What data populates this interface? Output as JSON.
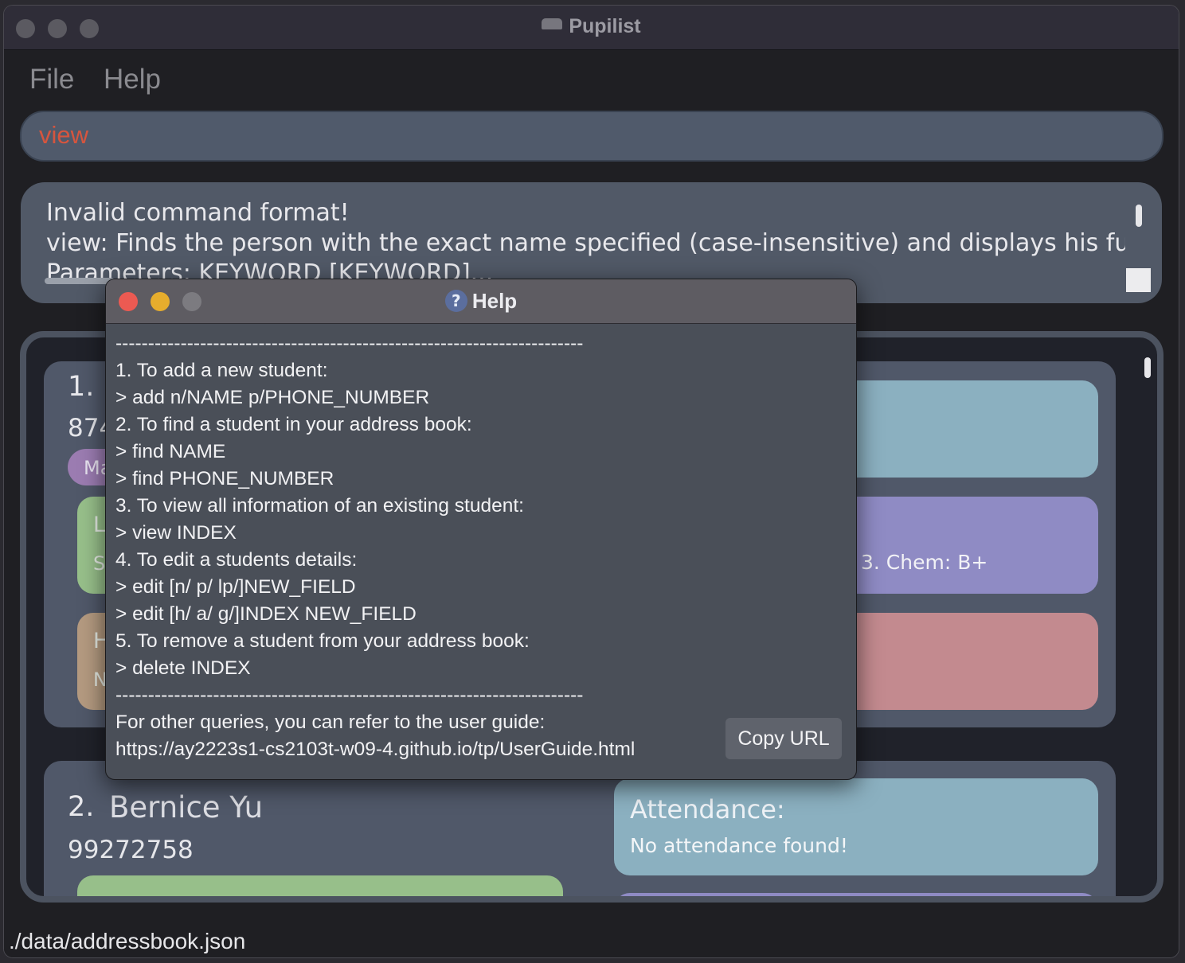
{
  "window": {
    "title": "Pupilist"
  },
  "menu": {
    "file": "File",
    "help": "Help"
  },
  "command": {
    "value": "view"
  },
  "result": {
    "text": "Invalid command format!\nview: Finds the person with the exact name specified (case-insensitive) and displays his full details\nParameters: KEYWORD [KEYWORD]..."
  },
  "persons": [
    {
      "index": "1.",
      "phone": "874",
      "tag": "Ma",
      "lesson_visible": [
        "L",
        "S"
      ],
      "homework_visible": [
        "H",
        "N"
      ],
      "grades_text": "3. Chem: B+"
    },
    {
      "index": "2.",
      "name": "Bernice Yu",
      "phone": "99272758",
      "attendance_title": "Attendance:",
      "attendance_body": "No attendance found!"
    }
  ],
  "status": {
    "path": "./data/addressbook.json"
  },
  "help_dialog": {
    "title": "Help",
    "lines": [
      "------------------------------------------------------------------------",
      "1. To add a new student:",
      "> add n/NAME p/PHONE_NUMBER",
      "2. To find a student in your address book:",
      "> find NAME",
      "> find PHONE_NUMBER",
      "3. To view all information of an existing student:",
      "> view INDEX",
      "4. To edit a students details:",
      "> edit [n/ p/ lp/]NEW_FIELD",
      "> edit [h/ a/ g/]INDEX NEW_FIELD",
      "5. To remove a student from your address book:",
      "> delete INDEX",
      "------------------------------------------------------------------------"
    ],
    "footer_line1": "For other queries, you can refer to the user guide:",
    "url": "https://ay2223s1-cs2103t-w09-4.github.io/tp/UserGuide.html",
    "copy_button": "Copy URL"
  },
  "colors": {
    "attendance": "#8bb0c0",
    "grades": "#8f8bc4",
    "homework": "#c38a8f",
    "lesson": "#97bf8a",
    "tag": "#9b7cb1",
    "close": "#ec5a52",
    "minimize": "#e6ad2d"
  }
}
